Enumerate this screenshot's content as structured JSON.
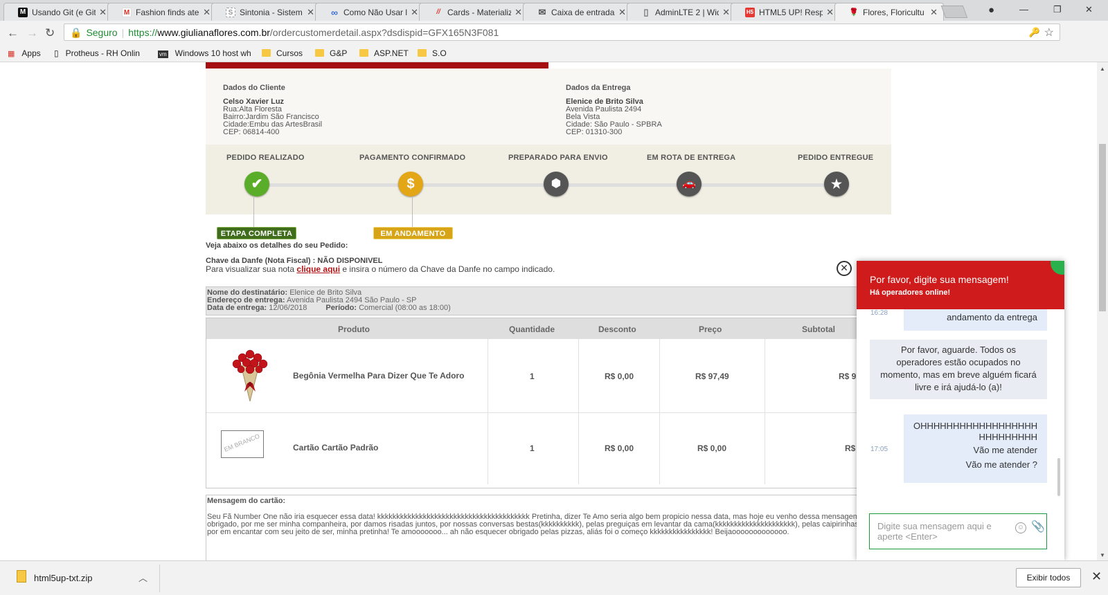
{
  "browser": {
    "tabs": [
      {
        "label": "Usando Git (e Git",
        "icon": "M",
        "color": "#111111"
      },
      {
        "label": "Fashion finds ate",
        "icon": "M",
        "color": "#d93025"
      },
      {
        "label": "Sintonia - Sistem",
        "icon": "S",
        "color": "#999999"
      },
      {
        "label": "Como Não Usar l",
        "icon": "∞",
        "color": "#3b6fd6"
      },
      {
        "label": "Cards - Materializ",
        "icon": "//",
        "color": "#e53935"
      },
      {
        "label": "Caixa de entrada",
        "icon": "✉",
        "color": "#555555"
      },
      {
        "label": "AdminLTE 2 | Wid",
        "icon": "▯",
        "color": "#777777"
      },
      {
        "label": "HTML5 UP! Respo",
        "icon": "H5",
        "color": "#e53935"
      },
      {
        "label": "Flores, Floricultu",
        "icon": "🌹",
        "color": "#c62828"
      }
    ],
    "address": {
      "secure_label": "Seguro",
      "url_scheme": "https://",
      "url_host": "www.giulianaflores.com.br",
      "url_path": "/ordercustomerdetail.aspx?dsdispid=GFX165N3F081"
    },
    "bookmarks": [
      {
        "label": "Apps",
        "kind": "apps"
      },
      {
        "label": "Protheus - RH Onlin",
        "kind": "page"
      },
      {
        "label": "Windows 10 host wh",
        "kind": "vm"
      },
      {
        "label": "Cursos",
        "kind": "folder"
      },
      {
        "label": "G&P",
        "kind": "folder"
      },
      {
        "label": "ASP.NET",
        "kind": "folder"
      },
      {
        "label": "S.O",
        "kind": "folder"
      }
    ]
  },
  "order": {
    "customer": {
      "heading": "Dados do Cliente",
      "name": "Celso Xavier Luz",
      "street": "Rua:Alta Floresta",
      "district": "Bairro:Jardim São Francisco",
      "city": "Cidade:Embu das ArtesBrasil",
      "cep": "CEP: 06814-400"
    },
    "delivery": {
      "heading": "Dados da Entrega",
      "name": "Elenice de Brito Silva",
      "street": "Avenida Paulista 2494",
      "district": "Bela Vista",
      "city": "Cidade: São Paulo - SPBRA",
      "cep": "CEP: 01310-300"
    },
    "steps": [
      {
        "label": "PEDIDO REALIZADO",
        "icon": "check-icon",
        "glyph": "✔",
        "color": "#5aad28"
      },
      {
        "label": "PAGAMENTO CONFIRMADO",
        "icon": "dollar-icon",
        "glyph": "$",
        "color": "#e3a617"
      },
      {
        "label": "PREPARADO PARA ENVIO",
        "icon": "box-icon",
        "glyph": "⬢",
        "color": "#555555"
      },
      {
        "label": "EM ROTA DE ENTREGA",
        "icon": "car-icon",
        "glyph": "🚗",
        "color": "#555555"
      },
      {
        "label": "PEDIDO ENTREGUE",
        "icon": "star-icon",
        "glyph": "★",
        "color": "#555555"
      }
    ],
    "badge_complete": "ETAPA COMPLETA",
    "badge_progress": "EM ANDAMENTO",
    "details_intro": "Veja abaixo os detalhes do seu Pedido:",
    "danfe_label": "Chave da Danfe (Nota Fiscal) : NÃO DISPONIVEL",
    "danfe_text_before": "Para visualizar sua nota ",
    "danfe_link": "clique aqui",
    "danfe_text_after": " e insira o número da Chave da Danfe no campo indicado.",
    "recipient_label": "Nome do destinatário:",
    "recipient_value": "Elenice de Brito Silva",
    "address_label": "Endereço de entrega:",
    "address_value": "Avenida Paulista 2494 São Paulo - SP",
    "date_label": "Data de entrega:",
    "date_value": "12/06/2018",
    "period_label": "Período:",
    "period_value": "Comercial (08:00 as 18:00)",
    "table": {
      "headers": [
        "Produto",
        "Quantidade",
        "Desconto",
        "Preço",
        "Subtotal"
      ],
      "rows": [
        {
          "name": "Begônia Vermelha Para Dizer Que Te Adoro",
          "qty": "1",
          "discount": "R$ 0,00",
          "price": "R$ 97,49",
          "subtotal": "R$ 9"
        },
        {
          "name": "Cartão Cartão Padrão",
          "qty": "1",
          "discount": "R$ 0,00",
          "price": "R$ 0,00",
          "subtotal": "R$"
        }
      ],
      "card_stamp": "EM BRANCO"
    },
    "message_label": "Mensagem do cartão:",
    "message_text": "Seu Fã Number One não iria esquecer essa data! kkkkkkkkkkkkkkkkkkkkkkkkkkkkkkkkkkkkkkkk Pretinha, dizer Te Amo seria algo bem propicio nessa data, mas hoje eu venho dessa mensagem dizer obrigado, por me ser minha companheira, por damos risadas juntos, por nossas conversas bestas(kkkkkkkkkk), pelas preguiças em levantar da cama(kkkkkkkkkkkkkkkkkkkkk), pelas caipirinhas deliciosas, por em encantar com seu jeito de ser, minha pretinha! Te amooooooo... ah não esquecer obrigado pelas pizzas, aliás foi o começo kkkkkkkkkkkkkkkk! Beijaooooooooooooo."
  },
  "chat": {
    "title": "Por favor, digite sua mensagem!",
    "subtitle": "Há operadores online!",
    "messages": [
      {
        "time": "16:28",
        "text": "andamento da entrega"
      },
      {
        "time": "",
        "text": "Por favor, aguarde. Todos os operadores estão ocupados no momento, mas em breve alguém ficará livre e irá ajudá-lo (a)!"
      },
      {
        "time": "17:05",
        "line1": "OHHHHHHHHHHHHHHHHHH",
        "line2": "HHHHHHHHH",
        "line3": "Vão me atender",
        "line4": "Vão me atender ?"
      }
    ],
    "input_placeholder": "Digite sua mensagem aqui e aperte <Enter>"
  },
  "downloads": {
    "file": "html5up-txt.zip",
    "show_all": "Exibir todos"
  }
}
